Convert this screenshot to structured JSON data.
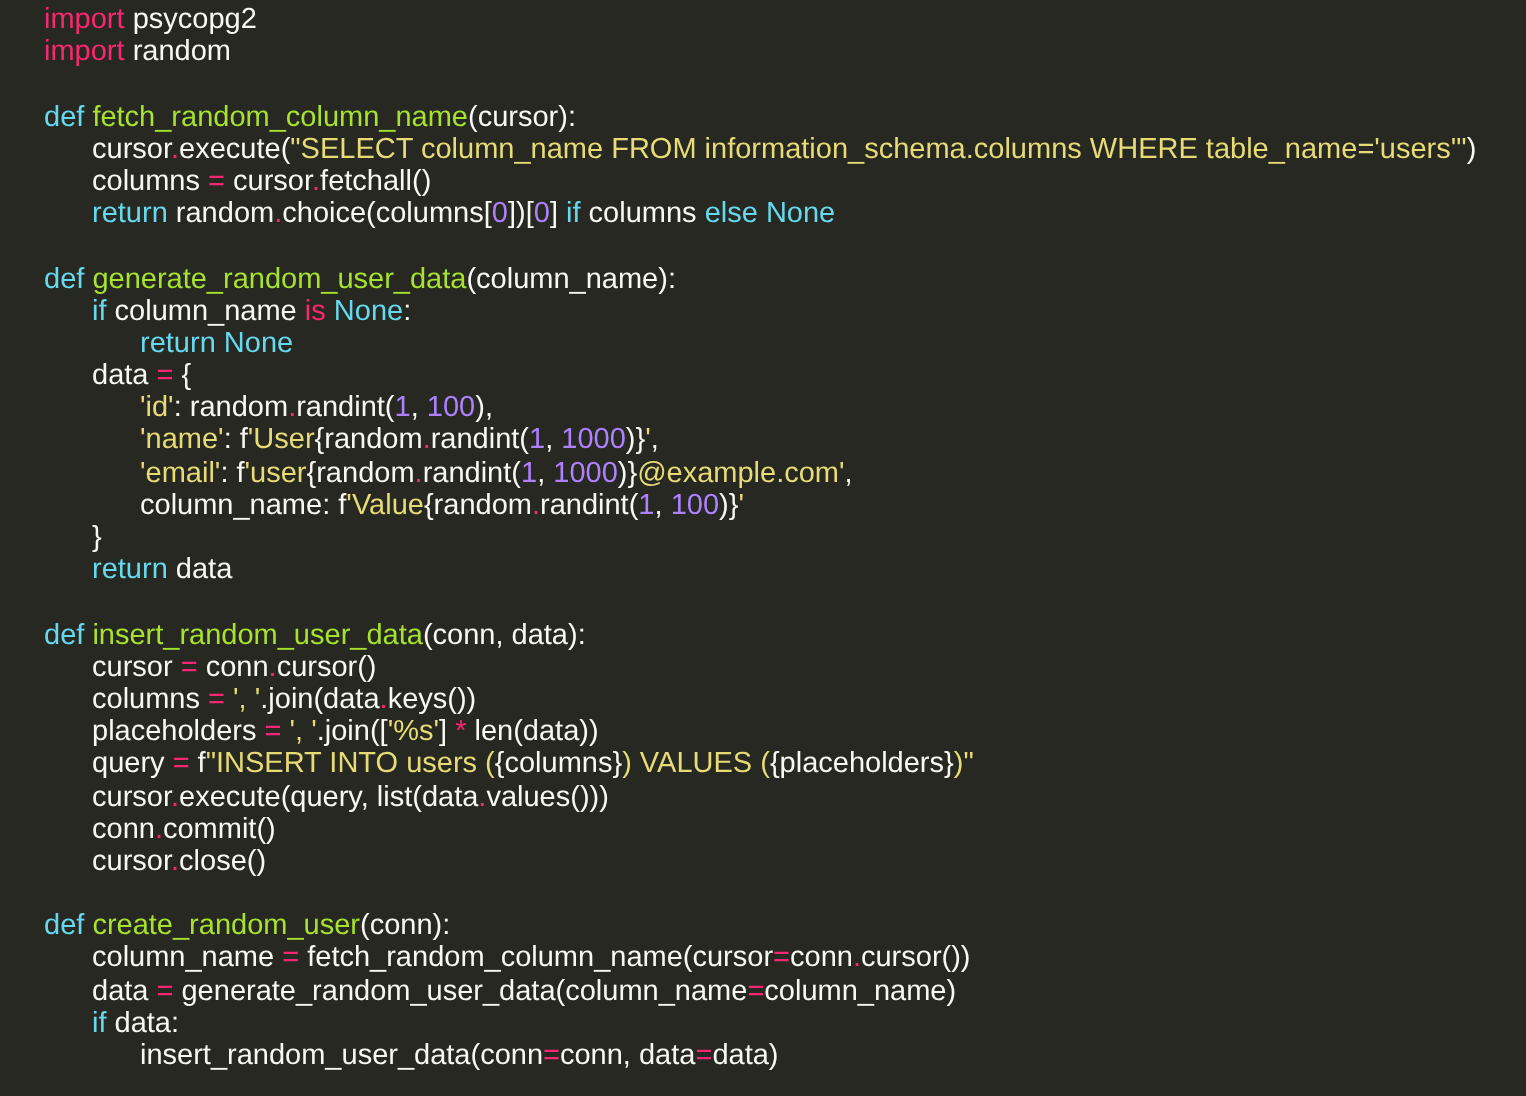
{
  "editor": {
    "lines": [
      {
        "kind": "code",
        "tokens": [
          {
            "kind": "operator",
            "text": "import"
          },
          {
            "kind": "plain",
            "text": " psycopg2"
          }
        ]
      },
      {
        "kind": "code",
        "tokens": [
          {
            "kind": "operator",
            "text": "import"
          },
          {
            "kind": "plain",
            "text": " random"
          }
        ]
      },
      {
        "kind": "blank"
      },
      {
        "kind": "code",
        "tokens": [
          {
            "kind": "keyword",
            "text": "def "
          },
          {
            "kind": "function",
            "text": "fetch_random_column_name"
          },
          {
            "kind": "plain",
            "text": "(cursor):"
          }
        ]
      },
      {
        "kind": "code",
        "tokens": [
          {
            "kind": "plain",
            "text": "\tcursor"
          },
          {
            "kind": "operator",
            "text": "."
          },
          {
            "kind": "plain",
            "text": "execute("
          },
          {
            "kind": "string",
            "text": "\"SELECT column_name FROM information_schema.columns WHERE table_name='users'\""
          },
          {
            "kind": "plain",
            "text": ")"
          }
        ]
      },
      {
        "kind": "code",
        "tokens": [
          {
            "kind": "plain",
            "text": "\tcolumns "
          },
          {
            "kind": "operator",
            "text": "="
          },
          {
            "kind": "plain",
            "text": " cursor"
          },
          {
            "kind": "operator",
            "text": "."
          },
          {
            "kind": "plain",
            "text": "fetchall()"
          }
        ]
      },
      {
        "kind": "code",
        "tokens": [
          {
            "kind": "keyword",
            "text": "\treturn"
          },
          {
            "kind": "plain",
            "text": " random"
          },
          {
            "kind": "operator",
            "text": "."
          },
          {
            "kind": "plain",
            "text": "choice(columns["
          },
          {
            "kind": "number",
            "text": "0"
          },
          {
            "kind": "plain",
            "text": "])["
          },
          {
            "kind": "number",
            "text": "0"
          },
          {
            "kind": "plain",
            "text": "] "
          },
          {
            "kind": "keyword",
            "text": "if"
          },
          {
            "kind": "plain",
            "text": " columns "
          },
          {
            "kind": "keyword",
            "text": "else None"
          }
        ]
      },
      {
        "kind": "blank"
      },
      {
        "kind": "code",
        "tokens": [
          {
            "kind": "keyword",
            "text": "def "
          },
          {
            "kind": "function",
            "text": "generate_random_user_data"
          },
          {
            "kind": "plain",
            "text": "(column_name):"
          }
        ]
      },
      {
        "kind": "code",
        "tokens": [
          {
            "kind": "keyword",
            "text": "\tif"
          },
          {
            "kind": "plain",
            "text": " column_name "
          },
          {
            "kind": "operator",
            "text": "is"
          },
          {
            "kind": "keyword",
            "text": " None"
          },
          {
            "kind": "plain",
            "text": ":"
          }
        ]
      },
      {
        "kind": "code",
        "tokens": [
          {
            "kind": "keyword",
            "text": "\t\treturn None"
          }
        ]
      },
      {
        "kind": "code",
        "tokens": [
          {
            "kind": "plain",
            "text": "\tdata "
          },
          {
            "kind": "operator",
            "text": "="
          },
          {
            "kind": "plain",
            "text": " {"
          }
        ]
      },
      {
        "kind": "code",
        "tokens": [
          {
            "kind": "string",
            "text": "\t\t'id'"
          },
          {
            "kind": "plain",
            "text": ": random"
          },
          {
            "kind": "operator",
            "text": "."
          },
          {
            "kind": "plain",
            "text": "randint("
          },
          {
            "kind": "number",
            "text": "1"
          },
          {
            "kind": "plain",
            "text": ", "
          },
          {
            "kind": "number",
            "text": "100"
          },
          {
            "kind": "plain",
            "text": "),"
          }
        ]
      },
      {
        "kind": "code",
        "tokens": [
          {
            "kind": "string",
            "text": "\t\t'name'"
          },
          {
            "kind": "plain",
            "text": ": f"
          },
          {
            "kind": "string",
            "text": "'User"
          },
          {
            "kind": "plain",
            "text": "{random"
          },
          {
            "kind": "operator",
            "text": "."
          },
          {
            "kind": "plain",
            "text": "randint("
          },
          {
            "kind": "number",
            "text": "1"
          },
          {
            "kind": "plain",
            "text": ", "
          },
          {
            "kind": "number",
            "text": "1000"
          },
          {
            "kind": "plain",
            "text": ")}"
          },
          {
            "kind": "string",
            "text": "'"
          },
          {
            "kind": "plain",
            "text": ","
          }
        ]
      },
      {
        "kind": "code",
        "tokens": [
          {
            "kind": "string",
            "text": "\t\t'email'"
          },
          {
            "kind": "plain",
            "text": ": f"
          },
          {
            "kind": "string",
            "text": "'user"
          },
          {
            "kind": "plain",
            "text": "{random"
          },
          {
            "kind": "operator",
            "text": "."
          },
          {
            "kind": "plain",
            "text": "randint("
          },
          {
            "kind": "number",
            "text": "1"
          },
          {
            "kind": "plain",
            "text": ", "
          },
          {
            "kind": "number",
            "text": "1000"
          },
          {
            "kind": "plain",
            "text": ")}"
          },
          {
            "kind": "string",
            "text": "@example.com'"
          },
          {
            "kind": "plain",
            "text": ","
          }
        ]
      },
      {
        "kind": "code",
        "tokens": [
          {
            "kind": "plain",
            "text": "\t\tcolumn_name: f"
          },
          {
            "kind": "string",
            "text": "'Value"
          },
          {
            "kind": "plain",
            "text": "{random"
          },
          {
            "kind": "operator",
            "text": "."
          },
          {
            "kind": "plain",
            "text": "randint("
          },
          {
            "kind": "number",
            "text": "1"
          },
          {
            "kind": "plain",
            "text": ", "
          },
          {
            "kind": "number",
            "text": "100"
          },
          {
            "kind": "plain",
            "text": ")}"
          },
          {
            "kind": "string",
            "text": "'"
          }
        ]
      },
      {
        "kind": "code",
        "tokens": [
          {
            "kind": "plain",
            "text": "\t}"
          }
        ]
      },
      {
        "kind": "code",
        "tokens": [
          {
            "kind": "keyword",
            "text": "\treturn"
          },
          {
            "kind": "plain",
            "text": " data"
          }
        ]
      },
      {
        "kind": "blank"
      },
      {
        "kind": "code",
        "tokens": [
          {
            "kind": "keyword",
            "text": "def "
          },
          {
            "kind": "function",
            "text": "insert_random_user_data"
          },
          {
            "kind": "plain",
            "text": "(conn, data):"
          }
        ]
      },
      {
        "kind": "code",
        "tokens": [
          {
            "kind": "plain",
            "text": "\tcursor "
          },
          {
            "kind": "operator",
            "text": "="
          },
          {
            "kind": "plain",
            "text": " conn"
          },
          {
            "kind": "operator",
            "text": "."
          },
          {
            "kind": "plain",
            "text": "cursor()"
          }
        ]
      },
      {
        "kind": "code",
        "tokens": [
          {
            "kind": "plain",
            "text": "\tcolumns "
          },
          {
            "kind": "operator",
            "text": "="
          },
          {
            "kind": "string",
            "text": " ', '"
          },
          {
            "kind": "plain",
            "text": ".join(data"
          },
          {
            "kind": "operator",
            "text": "."
          },
          {
            "kind": "plain",
            "text": "keys())"
          }
        ]
      },
      {
        "kind": "code",
        "tokens": [
          {
            "kind": "plain",
            "text": "\tplaceholders "
          },
          {
            "kind": "operator",
            "text": "="
          },
          {
            "kind": "string",
            "text": " ', '"
          },
          {
            "kind": "plain",
            "text": ".join(["
          },
          {
            "kind": "string",
            "text": "'%s'"
          },
          {
            "kind": "plain",
            "text": "] "
          },
          {
            "kind": "operator",
            "text": "*"
          },
          {
            "kind": "plain",
            "text": " len(data))"
          }
        ]
      },
      {
        "kind": "code",
        "tokens": [
          {
            "kind": "plain",
            "text": "\tquery "
          },
          {
            "kind": "operator",
            "text": "="
          },
          {
            "kind": "plain",
            "text": " f"
          },
          {
            "kind": "string",
            "text": "\"INSERT INTO users ("
          },
          {
            "kind": "plain",
            "text": "{columns}"
          },
          {
            "kind": "string",
            "text": ") VALUES ("
          },
          {
            "kind": "plain",
            "text": "{placeholders}"
          },
          {
            "kind": "string",
            "text": ")\""
          }
        ]
      },
      {
        "kind": "code",
        "tokens": [
          {
            "kind": "plain",
            "text": "\tcursor"
          },
          {
            "kind": "operator",
            "text": "."
          },
          {
            "kind": "plain",
            "text": "execute(query, list(data"
          },
          {
            "kind": "operator",
            "text": "."
          },
          {
            "kind": "plain",
            "text": "values()))"
          }
        ]
      },
      {
        "kind": "code",
        "tokens": [
          {
            "kind": "plain",
            "text": "\tconn"
          },
          {
            "kind": "operator",
            "text": "."
          },
          {
            "kind": "plain",
            "text": "commit()"
          }
        ]
      },
      {
        "kind": "code",
        "tokens": [
          {
            "kind": "plain",
            "text": "\tcursor"
          },
          {
            "kind": "operator",
            "text": "."
          },
          {
            "kind": "plain",
            "text": "close()"
          }
        ]
      },
      {
        "kind": "blank"
      },
      {
        "kind": "code",
        "tokens": [
          {
            "kind": "keyword",
            "text": "def "
          },
          {
            "kind": "function",
            "text": "create_random_user"
          },
          {
            "kind": "plain",
            "text": "(conn):"
          }
        ]
      },
      {
        "kind": "code",
        "tokens": [
          {
            "kind": "plain",
            "text": "\tcolumn_name "
          },
          {
            "kind": "operator",
            "text": "="
          },
          {
            "kind": "plain",
            "text": " fetch_random_column_name(cursor"
          },
          {
            "kind": "operator",
            "text": "="
          },
          {
            "kind": "plain",
            "text": "conn"
          },
          {
            "kind": "operator",
            "text": "."
          },
          {
            "kind": "plain",
            "text": "cursor())"
          }
        ]
      },
      {
        "kind": "code",
        "tokens": [
          {
            "kind": "plain",
            "text": "\tdata "
          },
          {
            "kind": "operator",
            "text": "="
          },
          {
            "kind": "plain",
            "text": " generate_random_user_data(column_name"
          },
          {
            "kind": "operator",
            "text": "="
          },
          {
            "kind": "plain",
            "text": "column_name)"
          }
        ]
      },
      {
        "kind": "code",
        "tokens": [
          {
            "kind": "keyword",
            "text": "\tif"
          },
          {
            "kind": "plain",
            "text": " data:"
          }
        ]
      },
      {
        "kind": "code",
        "tokens": [
          {
            "kind": "plain",
            "text": "\t\tinsert_random_user_data(conn"
          },
          {
            "kind": "operator",
            "text": "="
          },
          {
            "kind": "plain",
            "text": "conn, data"
          },
          {
            "kind": "operator",
            "text": "="
          },
          {
            "kind": "plain",
            "text": "data)"
          }
        ]
      }
    ]
  }
}
